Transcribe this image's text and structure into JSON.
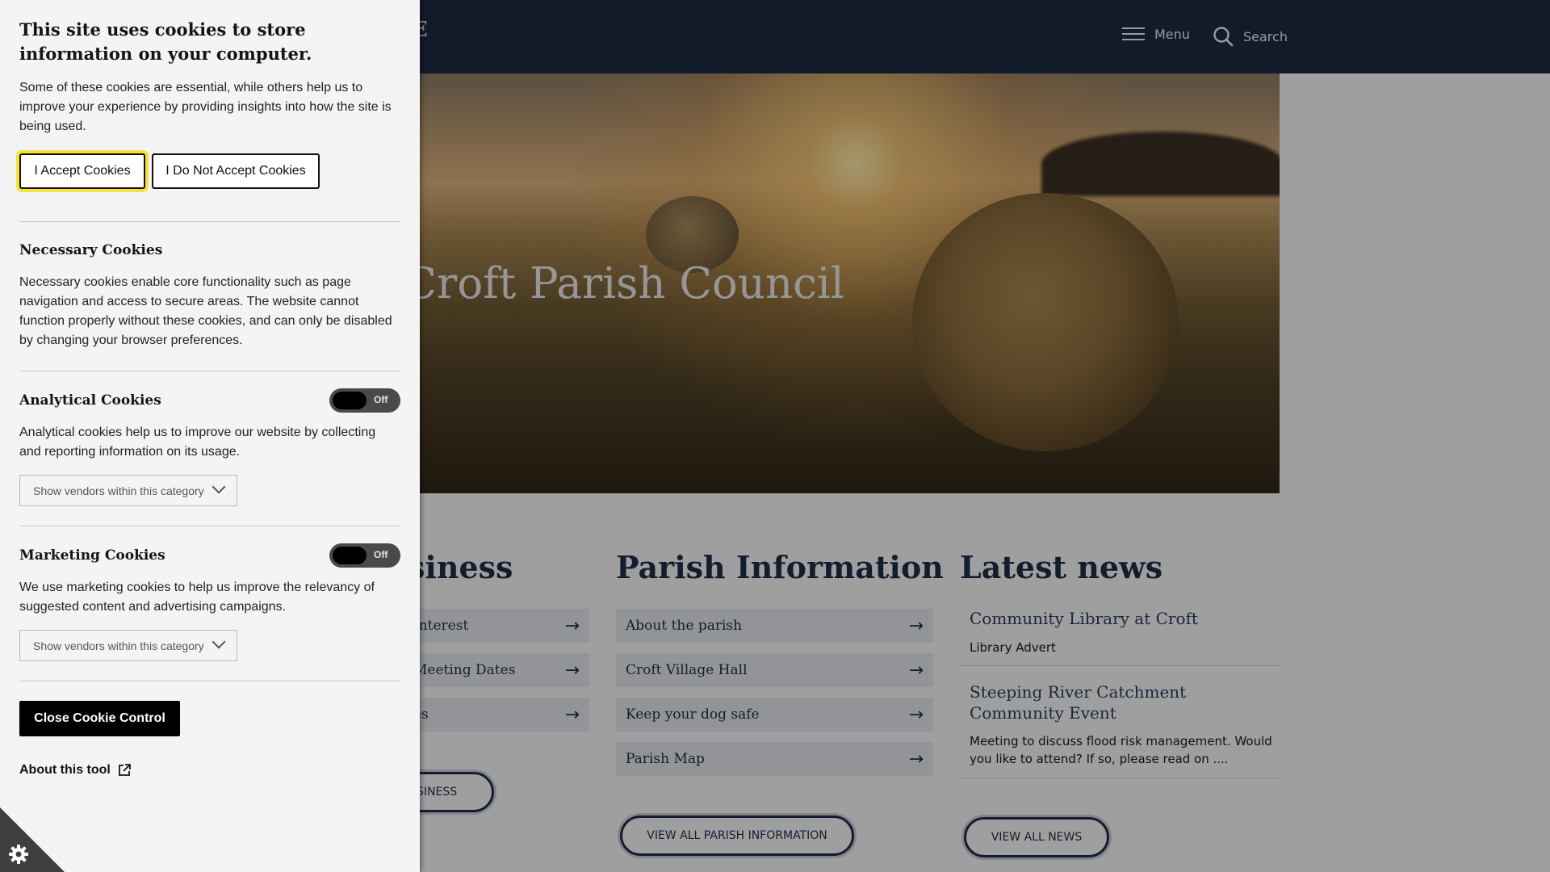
{
  "header": {
    "logo_fragment": "E",
    "menu_label": "Menu",
    "search_label": "Search"
  },
  "hero": {
    "title_visible": "ome to Croft Parish Council"
  },
  "business": {
    "heading_fragment": "siness",
    "links": [
      "Interest",
      "Meeting Dates",
      "es"
    ],
    "button_fragment": "USINESS"
  },
  "parish": {
    "heading": "Parish Information",
    "links": [
      "About the parish",
      "Croft Village Hall",
      "Keep your dog safe",
      "Parish Map"
    ],
    "button": "VIEW ALL PARISH INFORMATION"
  },
  "news": {
    "heading": "Latest news",
    "items": [
      {
        "title": "Community Library at Croft",
        "desc": "Library Advert"
      },
      {
        "title": "Steeping River Catchment Community Event",
        "desc": "Meeting to discuss flood risk management. Would you like to attend? If so, please read on ...."
      }
    ],
    "button": "VIEW ALL NEWS"
  },
  "cookie": {
    "title": "This site uses cookies to store information on your computer.",
    "intro": "Some of these cookies are essential, while others help us to improve your experience by providing insights into how the site is being used.",
    "accept_label": "I Accept Cookies",
    "decline_label": "I Do Not Accept Cookies",
    "necessary": {
      "heading": "Necessary Cookies",
      "text": "Necessary cookies enable core functionality such as page navigation and access to secure areas. The website cannot function properly without these cookies, and can only be disabled by changing your browser preferences."
    },
    "analytical": {
      "heading": "Analytical Cookies",
      "toggle_state": "Off",
      "text": "Analytical cookies help us to improve our website by collecting and reporting information on its usage.",
      "vendors_label": "Show vendors within this category"
    },
    "marketing": {
      "heading": "Marketing Cookies",
      "toggle_state": "Off",
      "text": "We use marketing cookies to help us improve the relevancy of suggested content and advertising campaigns.",
      "vendors_label": "Show vendors within this category"
    },
    "close_label": "Close Cookie Control",
    "about_label": "About this tool"
  },
  "colors": {
    "header_bg": "#1c2a40",
    "accent_navy": "#1f2d47",
    "focus_yellow": "#f6e23c"
  },
  "icons": [
    "hamburger-icon",
    "search-icon",
    "arrow-right-icon",
    "chevron-down-icon",
    "external-link-icon",
    "gear-icon"
  ]
}
